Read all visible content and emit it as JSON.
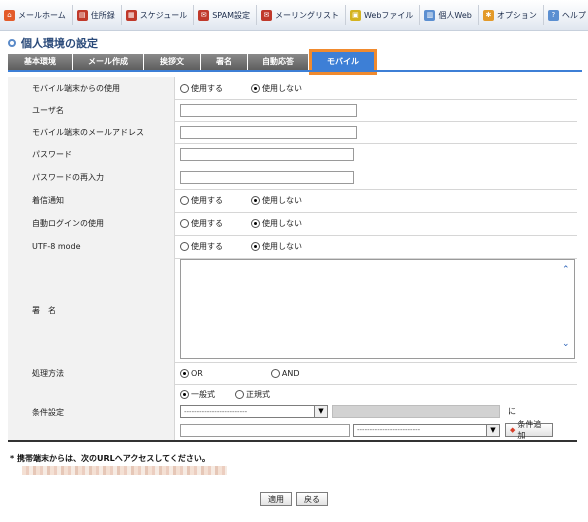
{
  "nav": {
    "items": [
      {
        "label": "メールホーム",
        "icon": "home-icon",
        "color": "#e35b2a"
      },
      {
        "label": "住所録",
        "icon": "address-book-icon",
        "color": "#c0392b"
      },
      {
        "label": "スケジュール",
        "icon": "calendar-icon",
        "color": "#c0392b"
      },
      {
        "label": "SPAM設定",
        "icon": "spam-icon",
        "color": "#c0392b"
      },
      {
        "label": "メーリングリスト",
        "icon": "mailing-list-icon",
        "color": "#c0392b"
      },
      {
        "label": "Webファイル",
        "icon": "web-file-icon",
        "color": "#d4b31f"
      },
      {
        "label": "個人Web",
        "icon": "personal-web-icon",
        "color": "#5b8fd1"
      },
      {
        "label": "オプション",
        "icon": "options-icon",
        "color": "#e39a2a"
      },
      {
        "label": "ヘルプ",
        "icon": "help-icon",
        "color": "#5b8fd1"
      }
    ]
  },
  "page_title": "個人環境の設定",
  "tabs": [
    "基本環境",
    "メール作成",
    "挨拶文",
    "署名",
    "自動応答",
    "モバイル"
  ],
  "active_tab": "モバイル",
  "form": {
    "mobile_use": {
      "label": "モバイル端末からの使用",
      "opt_on": "使用する",
      "opt_off": "使用しない",
      "selected": "使用しない"
    },
    "username": {
      "label": "ユーザ名",
      "value": ""
    },
    "mobile_email": {
      "label": "モバイル端末のメールアドレス",
      "value": ""
    },
    "password": {
      "label": "パスワード",
      "value": ""
    },
    "password_confirm": {
      "label": "パスワードの再入力",
      "value": ""
    },
    "notify": {
      "label": "着信通知",
      "opt_on": "使用する",
      "opt_off": "使用しない",
      "selected": "使用しない"
    },
    "auto_login": {
      "label": "自動ログインの使用",
      "opt_on": "使用する",
      "opt_off": "使用しない",
      "selected": "使用しない"
    },
    "utf8": {
      "label": "UTF-8 mode",
      "opt_on": "使用する",
      "opt_off": "使用しない",
      "selected": "使用しない"
    },
    "signature": {
      "label": "署　名",
      "value": ""
    },
    "processing": {
      "label": "処理方法",
      "opt_or": "OR",
      "opt_and": "AND",
      "selected": "OR"
    },
    "condition": {
      "label": "条件設定",
      "opt_general": "一般式",
      "opt_regex": "正規式",
      "selected": "一般式",
      "select1": "-------------------------",
      "suffix": "に",
      "select2": "-------------------------",
      "add_button": "条件追加"
    }
  },
  "note": "* 携帯端末からは、次のURLへアクセスしてください。",
  "buttons": {
    "apply": "適用",
    "back": "戻る"
  }
}
